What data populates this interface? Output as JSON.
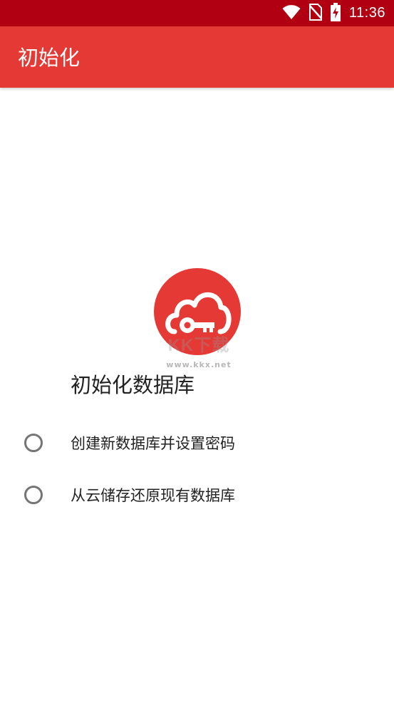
{
  "status_bar": {
    "time": "11:36",
    "icons": [
      "wifi-icon",
      "no-sim-icon",
      "battery-charging-icon"
    ],
    "color": "#b10012"
  },
  "app_bar": {
    "title": "初始化",
    "color": "#e53935"
  },
  "main": {
    "logo_icon": "cloud-key-icon",
    "watermark": {
      "main": "KK下载",
      "url": "www.kkx.net"
    },
    "heading": "初始化数据库",
    "options": [
      {
        "label": "创建新数据库并设置密码",
        "selected": false
      },
      {
        "label": "从云储存还原现有数据库",
        "selected": false
      }
    ]
  }
}
